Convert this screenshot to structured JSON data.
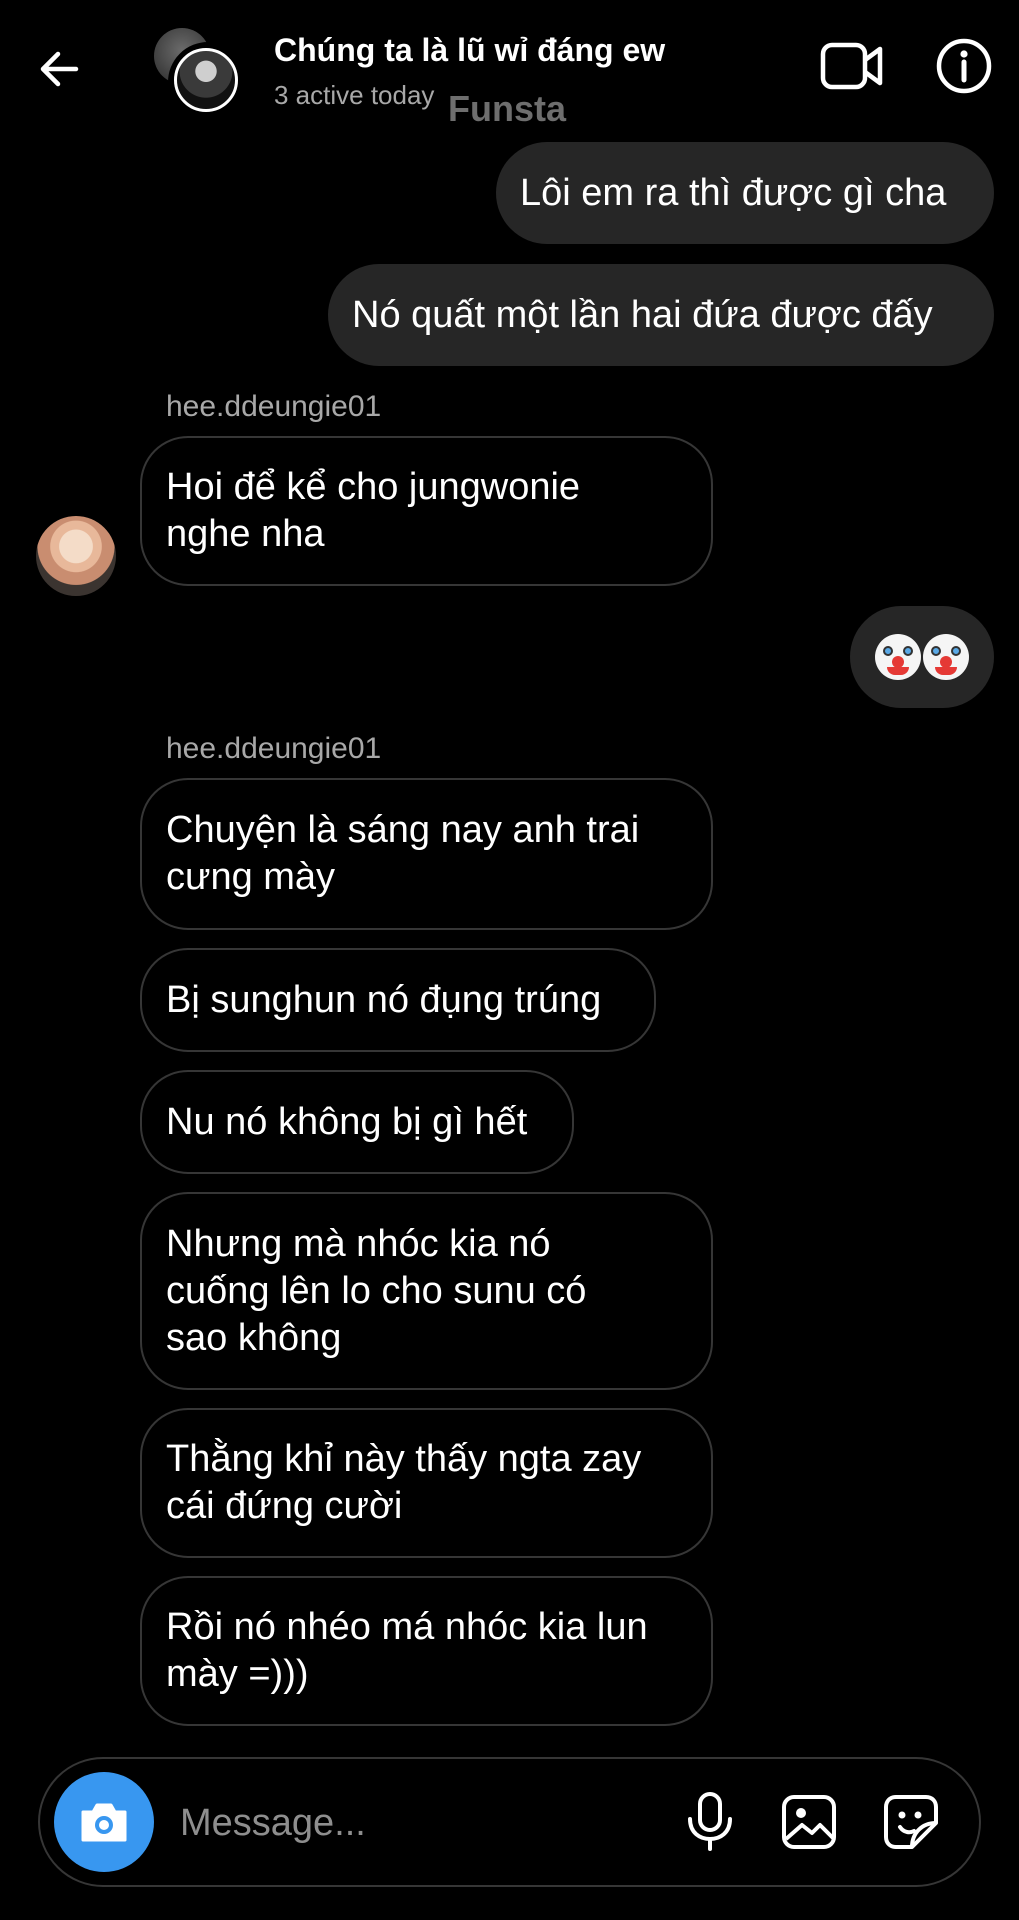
{
  "header": {
    "title": "Chúng ta là lũ wỉ đáng ew",
    "subtitle": "3 active today",
    "watermark": "Funsta"
  },
  "messages": [
    {
      "type": "sent",
      "text": "Lôi em ra thì được gì cha"
    },
    {
      "type": "sent",
      "text": "Nó quất một lần hai đứa được đấy"
    },
    {
      "type": "sender",
      "text": "hee.ddeungie01"
    },
    {
      "type": "received",
      "text": "Hoi để kể cho jungwonie\nnghe nha"
    },
    {
      "type": "sent-emoji",
      "text": "🤡🤡"
    },
    {
      "type": "sender",
      "text": "hee.ddeungie01"
    },
    {
      "type": "received",
      "text": "Chuyện là sáng nay anh trai\ncưng mày"
    },
    {
      "type": "received",
      "text": "Bị sunghun nó đụng trúng"
    },
    {
      "type": "received",
      "text": "Nu nó không bị gì hết"
    },
    {
      "type": "received",
      "text": "Nhưng mà nhóc kia nó\ncuống lên lo cho sunu có\nsao không"
    },
    {
      "type": "received",
      "text": "Thằng khỉ này thấy ngta zay\ncái đứng cười"
    },
    {
      "type": "received",
      "text": "Rồi nó nhéo má nhóc kia lun\nmày =)))"
    }
  ],
  "composer": {
    "placeholder": "Message..."
  },
  "icons": {
    "back": "arrow-left-icon",
    "video": "video-camera-icon",
    "info": "info-icon",
    "camera": "camera-icon",
    "mic": "microphone-icon",
    "gallery": "image-icon",
    "sticker": "sticker-icon"
  },
  "colors": {
    "background": "#000000",
    "sent_bubble": "#262626",
    "received_border": "#363636",
    "secondary_text": "#a8a8a8",
    "camera_button": "#3897f0"
  }
}
